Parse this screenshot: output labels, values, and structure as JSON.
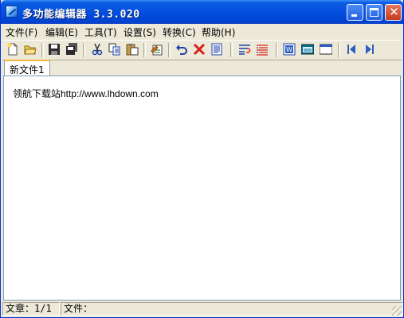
{
  "window": {
    "title": "多功能编辑器 3.3.020"
  },
  "menu": [
    {
      "label": "文件(F)"
    },
    {
      "label": "编辑(E)"
    },
    {
      "label": "工具(T)"
    },
    {
      "label": "设置(S)"
    },
    {
      "label": "转换(C)"
    },
    {
      "label": "帮助(H)"
    }
  ],
  "tabs": [
    {
      "label": "新文件1"
    }
  ],
  "editor": {
    "content": "领航下载站http://www.lhdown.com"
  },
  "status": {
    "article": "文章：1/1",
    "file": "文件："
  },
  "colors": {
    "titlebar": "#0a5cdf",
    "chrome": "#ece9d8",
    "tab_accent": "#f4b63a"
  }
}
